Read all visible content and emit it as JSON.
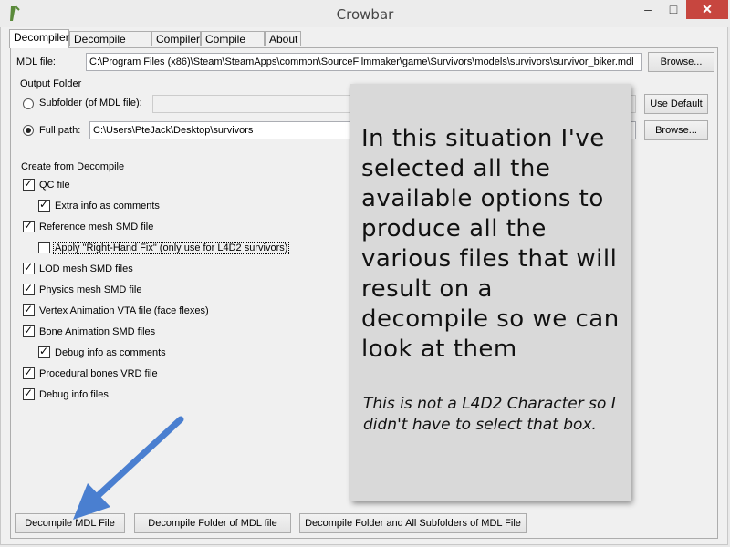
{
  "window": {
    "title": "Crowbar"
  },
  "titlebar": {
    "minimize": "–",
    "maximize": "□",
    "close": "✕"
  },
  "tabs": [
    {
      "label": "Decompiler",
      "active": true
    },
    {
      "label": "Decompile Log"
    },
    {
      "label": "Compiler"
    },
    {
      "label": "Compile Log"
    },
    {
      "label": "About"
    }
  ],
  "mdl": {
    "label": "MDL file:",
    "value": "C:\\Program Files (x86)\\Steam\\SteamApps\\common\\SourceFilmmaker\\game\\Survivors\\models\\survivors\\survivor_biker.mdl",
    "browse_label": "Browse..."
  },
  "output": {
    "group_label": "Output Folder",
    "subfolder_label": "Subfolder (of MDL file):",
    "subfolder_value": "",
    "use_default_label": "Use Default",
    "fullpath_label": "Full path:",
    "fullpath_value": "C:\\Users\\PteJack\\Desktop\\survivors",
    "browse_label": "Browse..."
  },
  "create": {
    "group_label": "Create from Decompile",
    "options": [
      {
        "label": "QC file",
        "checked": true
      },
      {
        "label": "Extra info as comments",
        "checked": true
      },
      {
        "label": "Reference mesh SMD file",
        "checked": true
      },
      {
        "label": "Apply \"Right-Hand Fix\" (only use for L4D2 survivors)",
        "checked": false
      },
      {
        "label": "LOD mesh SMD files",
        "checked": true
      },
      {
        "label": "Physics mesh SMD file",
        "checked": true
      },
      {
        "label": "Vertex Animation VTA file (face flexes)",
        "checked": true
      },
      {
        "label": "Bone Animation SMD files",
        "checked": true
      },
      {
        "label": "Debug info as comments",
        "checked": true
      },
      {
        "label": "Procedural bones VRD file",
        "checked": true
      },
      {
        "label": "Debug info files",
        "checked": true
      }
    ]
  },
  "actions": {
    "decompile_file": "Decompile MDL File",
    "decompile_folder": "Decompile Folder of MDL file",
    "decompile_all": "Decompile Folder and All Subfolders of MDL File"
  },
  "note": {
    "main": "In this situation I've selected all the available options to produce all the various files that will result on a decompile so we can look at them",
    "aside": "This is not a L4D2 Character so I didn't have to select that box."
  },
  "colors": {
    "arrow": "#4a7fd0",
    "close_button": "#c7463f",
    "note_background": "#d9d9d9"
  },
  "icons": {
    "app": "crowbar-icon",
    "arrow": "annotation-arrow"
  }
}
